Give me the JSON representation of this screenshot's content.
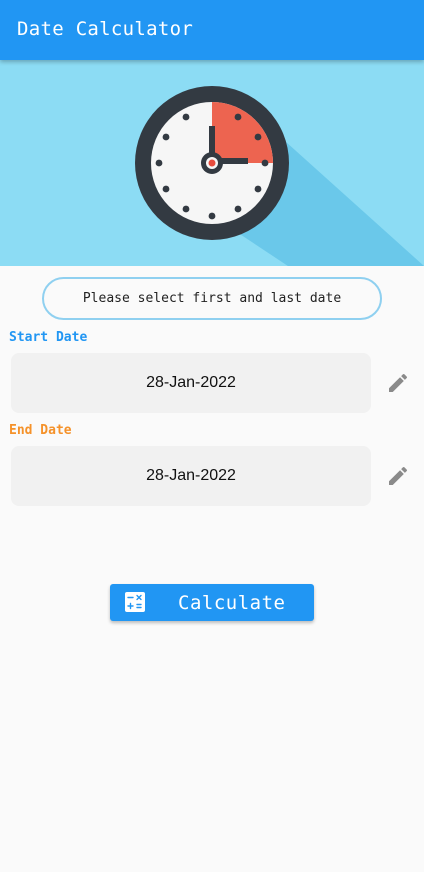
{
  "app_bar": {
    "title": "Date Calculator"
  },
  "hero": {
    "icon": "clock-icon",
    "colors": {
      "background": "#8cdcf4",
      "shadow": "#6ac8ea",
      "rim": "#333a42",
      "face": "#f6f6f6",
      "highlight": "#ed6450",
      "center_dot": "#e84c3d"
    }
  },
  "hint": {
    "text": "Please select first and last date"
  },
  "start": {
    "label": "Start Date",
    "value": "28-Jan-2022",
    "edit_icon": "pencil-icon"
  },
  "end": {
    "label": "End Date",
    "value": "28-Jan-2022",
    "edit_icon": "pencil-icon"
  },
  "calculate": {
    "label": "Calculate",
    "icon": "calculator-icon"
  },
  "colors": {
    "primary": "#2196f3",
    "start_label": "#2196f3",
    "end_label": "#f5922a",
    "pill_border": "#8fd0f0",
    "date_box": "#f1f1f1",
    "edit_icon": "#8a8a8a"
  }
}
